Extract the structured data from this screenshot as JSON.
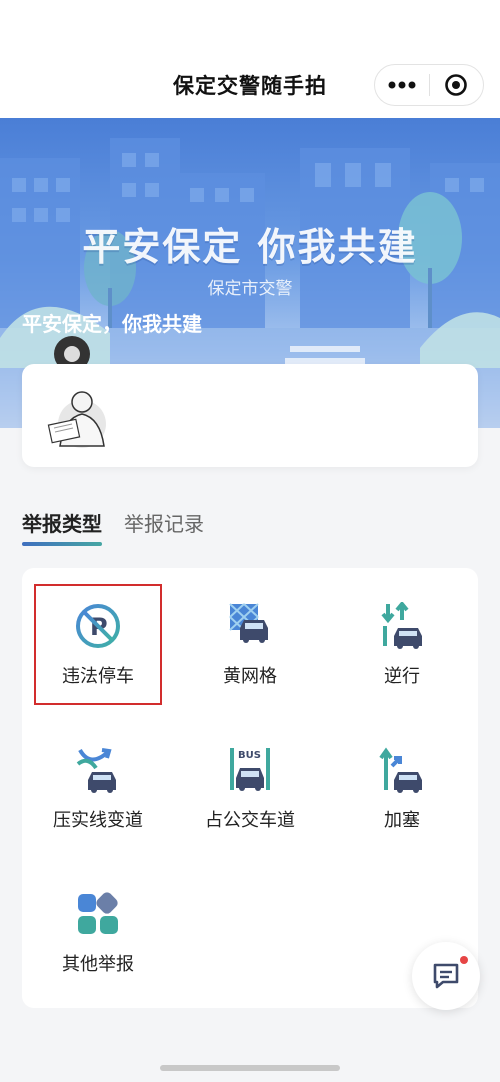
{
  "header": {
    "title": "保定交警随手拍",
    "more_icon": "more-dots-icon",
    "close_icon": "target-close-icon"
  },
  "banner": {
    "slogan": "平安保定 你我共建",
    "subtitle": "保定市交警",
    "caption": "平安保定，你我共建"
  },
  "tabs": [
    {
      "label": "举报类型",
      "active": true
    },
    {
      "label": "举报记录",
      "active": false
    }
  ],
  "report_types": [
    {
      "label": "违法停车",
      "icon": "no-parking-icon"
    },
    {
      "label": "黄网格",
      "icon": "yellow-grid-car-icon"
    },
    {
      "label": "逆行",
      "icon": "wrong-way-icon"
    },
    {
      "label": "压实线变道",
      "icon": "lane-change-icon"
    },
    {
      "label": "占公交车道",
      "icon": "bus-lane-icon"
    },
    {
      "label": "加塞",
      "icon": "cut-in-icon"
    },
    {
      "label": "其他举报",
      "icon": "other-report-icon"
    }
  ],
  "colors": {
    "accent_blue": "#3f6fbf",
    "accent_teal": "#46a6a3",
    "highlight_red": "#d22d2d"
  }
}
